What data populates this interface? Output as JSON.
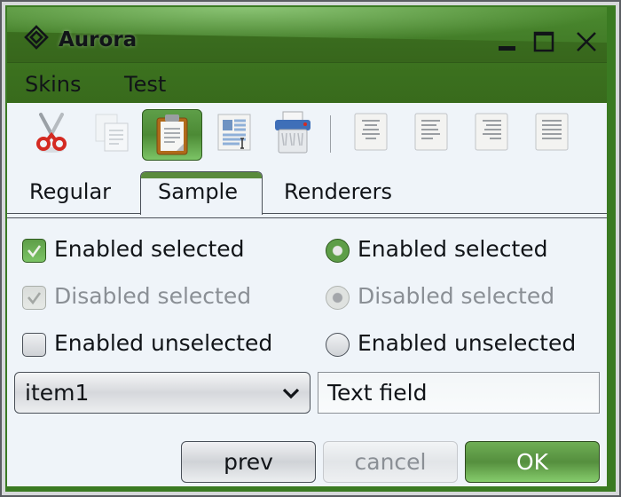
{
  "window": {
    "title": "Aurora",
    "logo_icon": "aurora-diamond-icon",
    "controls": [
      "minimize-icon",
      "maximize-icon",
      "close-icon"
    ]
  },
  "menubar": {
    "items": [
      {
        "label": "Skins"
      },
      {
        "label": "Test"
      }
    ]
  },
  "toolbar": {
    "buttons": [
      {
        "name": "cut",
        "icon": "scissors-icon",
        "active": false,
        "enabled": true
      },
      {
        "name": "copy",
        "icon": "copy-icon",
        "active": false,
        "enabled": false
      },
      {
        "name": "paste",
        "icon": "clipboard-icon",
        "active": true,
        "enabled": true
      },
      {
        "name": "select-all",
        "icon": "text-select-icon",
        "active": false,
        "enabled": true
      },
      {
        "name": "delete",
        "icon": "shredder-icon",
        "active": false,
        "enabled": true
      },
      {
        "name": "align-center",
        "icon": "align-center-icon",
        "active": false,
        "enabled": true
      },
      {
        "name": "align-left",
        "icon": "align-left-icon",
        "active": false,
        "enabled": true
      },
      {
        "name": "align-right",
        "icon": "align-right-icon",
        "active": false,
        "enabled": true
      },
      {
        "name": "align-justify",
        "icon": "align-justify-icon",
        "active": false,
        "enabled": true
      }
    ]
  },
  "tabs": {
    "items": [
      {
        "label": "Regular",
        "selected": false
      },
      {
        "label": "Sample",
        "selected": true
      },
      {
        "label": "Renderers",
        "selected": false
      }
    ]
  },
  "checkboxes": [
    {
      "label": "Enabled selected",
      "checked": true,
      "enabled": true
    },
    {
      "label": "Disabled selected",
      "checked": true,
      "enabled": false
    },
    {
      "label": "Enabled unselected",
      "checked": false,
      "enabled": true
    }
  ],
  "radios": [
    {
      "label": "Enabled selected",
      "checked": true,
      "enabled": true
    },
    {
      "label": "Disabled selected",
      "checked": true,
      "enabled": false
    },
    {
      "label": "Enabled unselected",
      "checked": false,
      "enabled": true
    }
  ],
  "combo": {
    "selected": "item1"
  },
  "textfield": {
    "value": "Text field"
  },
  "buttons": {
    "prev": "prev",
    "cancel": "cancel",
    "ok": "OK"
  },
  "colors": {
    "accent": "#5a8b3c",
    "titlebar": "#3e7524",
    "content_bg": "#eff4f9"
  }
}
